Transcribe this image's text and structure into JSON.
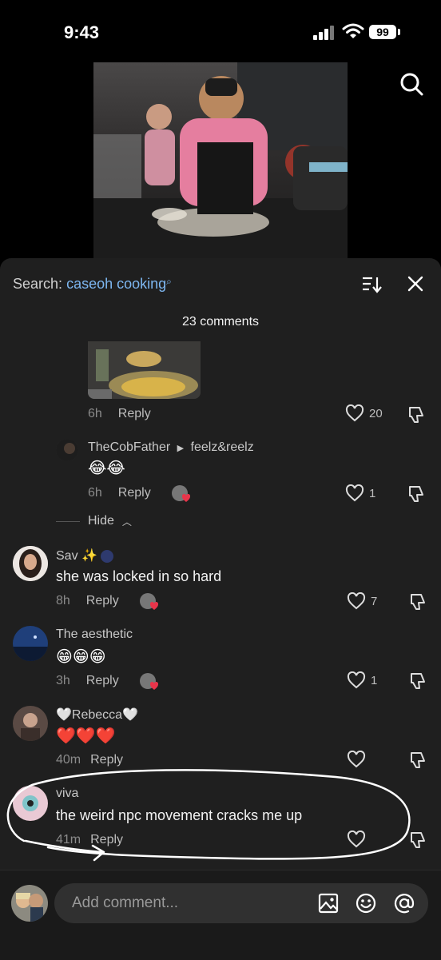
{
  "status": {
    "time": "9:43",
    "battery": "99"
  },
  "sheet": {
    "search_label": "Search:",
    "search_term": "caseoh cooking",
    "comment_count": "23 comments"
  },
  "comments": [
    {
      "id": "c0",
      "time": "6h",
      "reply": "Reply",
      "likes": "20"
    },
    {
      "id": "c1",
      "name": "TheCobFather",
      "reply_to": "feelz&reelz",
      "text": "😂😂",
      "time": "6h",
      "reply": "Reply",
      "likes": "1"
    },
    {
      "id": "c2",
      "name": "Sav ✨",
      "text": "she was locked in so hard",
      "time": "8h",
      "reply": "Reply",
      "likes": "7"
    },
    {
      "id": "c3",
      "name": "The aesthetic",
      "text": "😁😁😁",
      "time": "3h",
      "reply": "Reply",
      "likes": "1"
    },
    {
      "id": "c4",
      "name": "🤍Rebecca🤍",
      "text": "❤️❤️❤️",
      "time": "40m",
      "reply": "Reply",
      "likes": ""
    },
    {
      "id": "c5",
      "name": "viva",
      "text": "the weird npc movement cracks me up",
      "time": "41m",
      "reply": "Reply",
      "likes": ""
    }
  ],
  "hide_label": "Hide",
  "input": {
    "placeholder": "Add comment..."
  },
  "colors": {
    "accent": "#7db6f0",
    "sheet_bg": "#1f1f1f",
    "heart_red": "#e8344a"
  }
}
